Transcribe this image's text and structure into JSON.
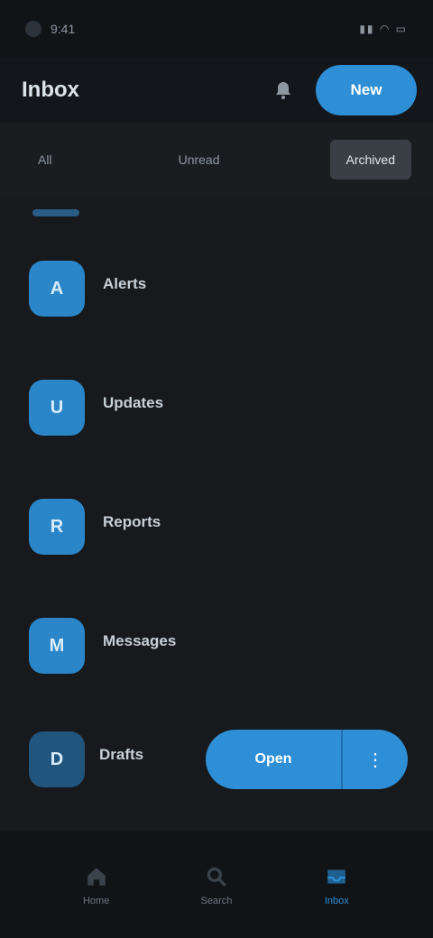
{
  "status_bar": {
    "time": "9:41",
    "indicators": "▮▮ ◠ ▭"
  },
  "header": {
    "title": "Inbox",
    "primary_action": "New"
  },
  "tabs": [
    {
      "label": "All"
    },
    {
      "label": "Unread"
    },
    {
      "label": "Archived"
    }
  ],
  "peek": {
    "text": ""
  },
  "items": [
    {
      "initials": "A",
      "title": "Alerts",
      "subtitle": ""
    },
    {
      "initials": "U",
      "title": "Updates",
      "subtitle": ""
    },
    {
      "initials": "R",
      "title": "Reports",
      "subtitle": ""
    },
    {
      "initials": "M",
      "title": "Messages",
      "subtitle": ""
    }
  ],
  "last_item": {
    "initials": "D",
    "title": "Drafts",
    "subtitle": ""
  },
  "action": {
    "main_label": "Open",
    "more_label": "⋮"
  },
  "bottom_nav": [
    {
      "label": "Home",
      "icon": "home-icon"
    },
    {
      "label": "Search",
      "icon": "search-icon"
    },
    {
      "label": "Inbox",
      "icon": "inbox-icon"
    }
  ],
  "colors": {
    "accent": "#2e8ed6",
    "background": "#17191c"
  }
}
